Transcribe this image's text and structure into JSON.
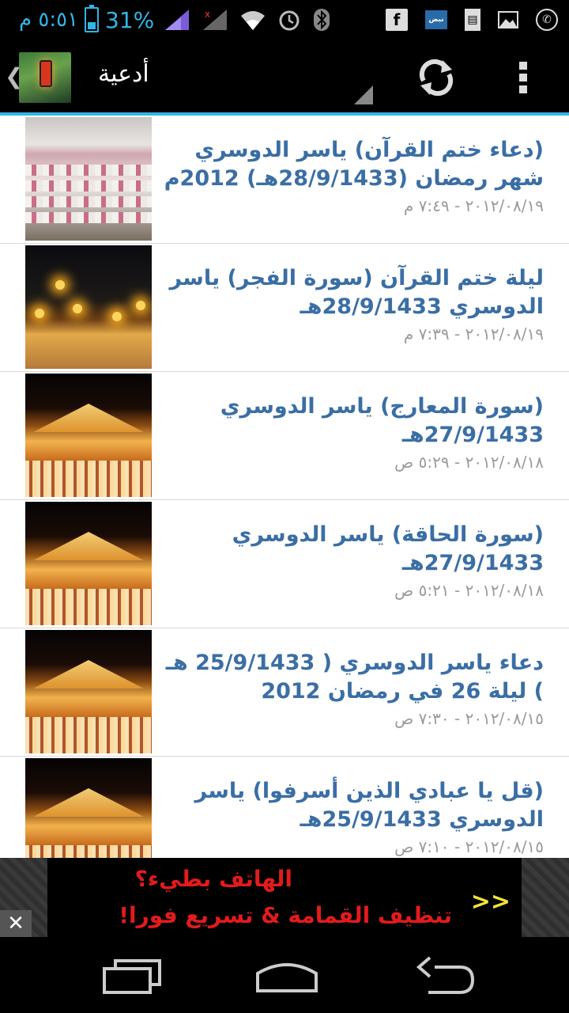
{
  "status_bar": {
    "time": "٥:٥١ م",
    "battery_percent": "31%",
    "battery_level": 0.31,
    "icons": [
      "signal-icon",
      "no-signal-icon",
      "wifi-icon",
      "alarm-icon",
      "bluetooth-icon",
      "facebook-icon",
      "news-icon",
      "document-icon",
      "gallery-icon",
      "whatsapp-icon"
    ],
    "news_label": "نبض"
  },
  "action_bar": {
    "title": "أدعية"
  },
  "list": {
    "items": [
      {
        "title": "(دعاء ختم القرآن) ياسر الدوسري شهر رمضان (28/9/1433هـ) 2012م",
        "date": "٢٠١٢/٠٨/١٩ - ٧:٤٩ م",
        "thumb": "crowd"
      },
      {
        "title": "ليلة ختم القرآن (سورة الفجر) ياسر الدوسري 28/9/1433هـ",
        "date": "٢٠١٢/٠٨/١٩ - ٧:٣٩ م",
        "thumb": "night"
      },
      {
        "title": "(سورة المعارج) ياسر الدوسري 27/9/1433هـ",
        "date": "٢٠١٢/٠٨/١٨ - ٥:٢٩ ص",
        "thumb": "tent"
      },
      {
        "title": "(سورة الحاقة) ياسر الدوسري 27/9/1433هـ",
        "date": "٢٠١٢/٠٨/١٨ - ٥:٢١ ص",
        "thumb": "tent"
      },
      {
        "title": "دعاء ياسر الدوسري ( 25/9/1433 هـ ) ليلة 26 في رمضان 2012",
        "date": "٢٠١٢/٠٨/١٥ - ٧:٣٠ ص",
        "thumb": "tent"
      },
      {
        "title": "(قل يا عبادي الذين أسرفوا) ياسر الدوسري 25/9/1433هـ",
        "date": "٢٠١٢/٠٨/١٥ - ٧:١٠ ص",
        "thumb": "tent"
      }
    ]
  },
  "ad": {
    "line1": "الهاتف بطيء؟",
    "line2": "تنظيف القمامة & تسريع فورا!",
    "arrow": ">>",
    "close": "✕"
  },
  "colors": {
    "accent": "#33b5e5",
    "title_text": "#3a6ea5",
    "date_text": "#9a9a9a",
    "ad_text": "#e31b1b"
  }
}
